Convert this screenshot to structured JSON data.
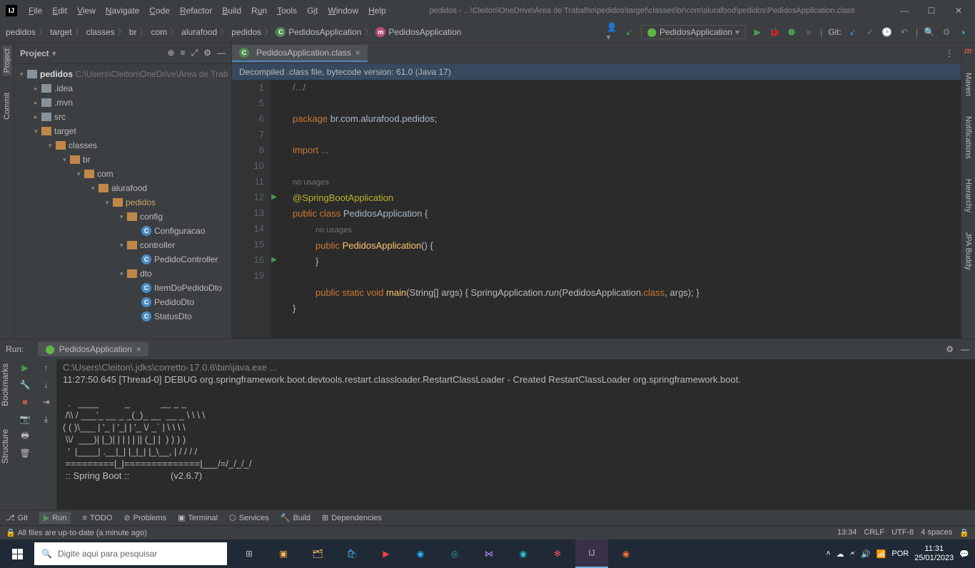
{
  "title": "pedidos - ...\\Cleiton\\OneDrive\\Área de Trabalho\\pedidos\\target\\classes\\br\\com\\alurafood\\pedidos\\PedidosApplication.class",
  "menu": {
    "file": "File",
    "edit": "Edit",
    "view": "View",
    "navigate": "Navigate",
    "code": "Code",
    "refactor": "Refactor",
    "build": "Build",
    "run": "Run",
    "tools": "Tools",
    "git": "Git",
    "window": "Window",
    "help": "Help"
  },
  "breadcrumb": [
    "pedidos",
    "target",
    "classes",
    "br",
    "com",
    "alurafood",
    "pedidos",
    "PedidosApplication",
    "PedidosApplication"
  ],
  "run_config": "PedidosApplication",
  "git_label": "Git:",
  "project_panel": {
    "title": "Project"
  },
  "tree": {
    "root": "pedidos",
    "root_path": "C:\\Users\\Cleiton\\OneDrive\\Área de Trab",
    "n_idea": ".idea",
    "n_mvn": ".mvn",
    "n_src": "src",
    "n_target": "target",
    "n_classes": "classes",
    "n_br": "br",
    "n_com": "com",
    "n_alurafood": "alurafood",
    "n_pedidos": "pedidos",
    "n_config": "config",
    "n_configuracao": "Configuracao",
    "n_controller": "controller",
    "n_pedidocontroller": "PedidoController",
    "n_dto": "dto",
    "n_itemdopedidodto": "ItemDoPedidoDto",
    "n_pedidodto": "PedidoDto",
    "n_statusdto": "StatusDto"
  },
  "editor_tab": "PedidosApplication.class",
  "info_bar": "Decompiled .class file, bytecode version: 61.0 (Java 17)",
  "gutter": [
    "1",
    "5",
    "6",
    "7",
    "8",
    "10",
    "",
    "11",
    "12",
    "",
    "13",
    "14",
    "15",
    "16",
    "19"
  ],
  "code": {
    "l1": "/.../",
    "l_package_kw": "package",
    "l_package_v": " br.com.alurafood.pedidos;",
    "l_import_kw": "import",
    "l_import_v": " ...",
    "no_usages": "no usages",
    "ann": "@SpringBootApplication",
    "pub": "public",
    "cls": "class",
    "name": "PedidosApplication",
    "brace": " {",
    "ctor_pub": "public",
    "ctor_name": "PedidosApplication",
    "ctor_rest": "() {",
    "ctor_close": "}",
    "m_pub": "public",
    "m_static": "static",
    "m_void": "void",
    "m_main": "main",
    "m_args": "(String[] args) { ",
    "m_call": "SpringApplication.",
    "m_run": "run",
    "m_rest": "(PedidosApplication.",
    "m_class": "class",
    "m_end": ", args); }",
    "close": "}"
  },
  "run_panel": {
    "label": "Run:",
    "tab": "PedidosApplication",
    "cmd": "C:\\Users\\Cleiton\\.jdks\\corretto-17.0.6\\bin\\java.exe ...",
    "log": "11:27:50.645 [Thread-0] DEBUG org.springframework.boot.devtools.restart.classloader.RestartClassLoader - Created RestartClassLoader org.springframework.boot.",
    "banner": "  .   ____          _            __ _ _\n /\\\\ / ___'_ __ _ _(_)_ __  __ _ \\ \\ \\ \\\n( ( )\\___ | '_ | '_| | '_ \\/ _` | \\ \\ \\ \\\n \\\\/  ___)| |_)| | | | | || (_| |  ) ) ) )\n  '  |____| .__|_| |_|_| |_\\__, | / / / /\n =========|_|==============|___/=/_/_/_/\n :: Spring Boot ::                (v2.6.7)"
  },
  "left_strip": {
    "project": "Project",
    "commit": "Commit",
    "bookmarks": "Bookmarks",
    "structure": "Structure"
  },
  "right_strip": {
    "m": "m",
    "maven": "Maven",
    "notifications": "Notifications",
    "hierarchy": "Hierarchy",
    "jpa": "JPA Buddy"
  },
  "bottom": {
    "git": "Git",
    "run": "Run",
    "todo": "TODO",
    "problems": "Problems",
    "terminal": "Terminal",
    "services": "Services",
    "build": "Build",
    "dependencies": "Dependencies"
  },
  "status": {
    "msg": "All files are up-to-date (a minute ago)",
    "pos": "13:34",
    "crlf": "CRLF",
    "enc": "UTF-8",
    "indent": "4 spaces"
  },
  "taskbar": {
    "search": "Digite aqui para pesquisar",
    "lang": "POR",
    "time": "11:31",
    "date": "25/01/2023"
  }
}
